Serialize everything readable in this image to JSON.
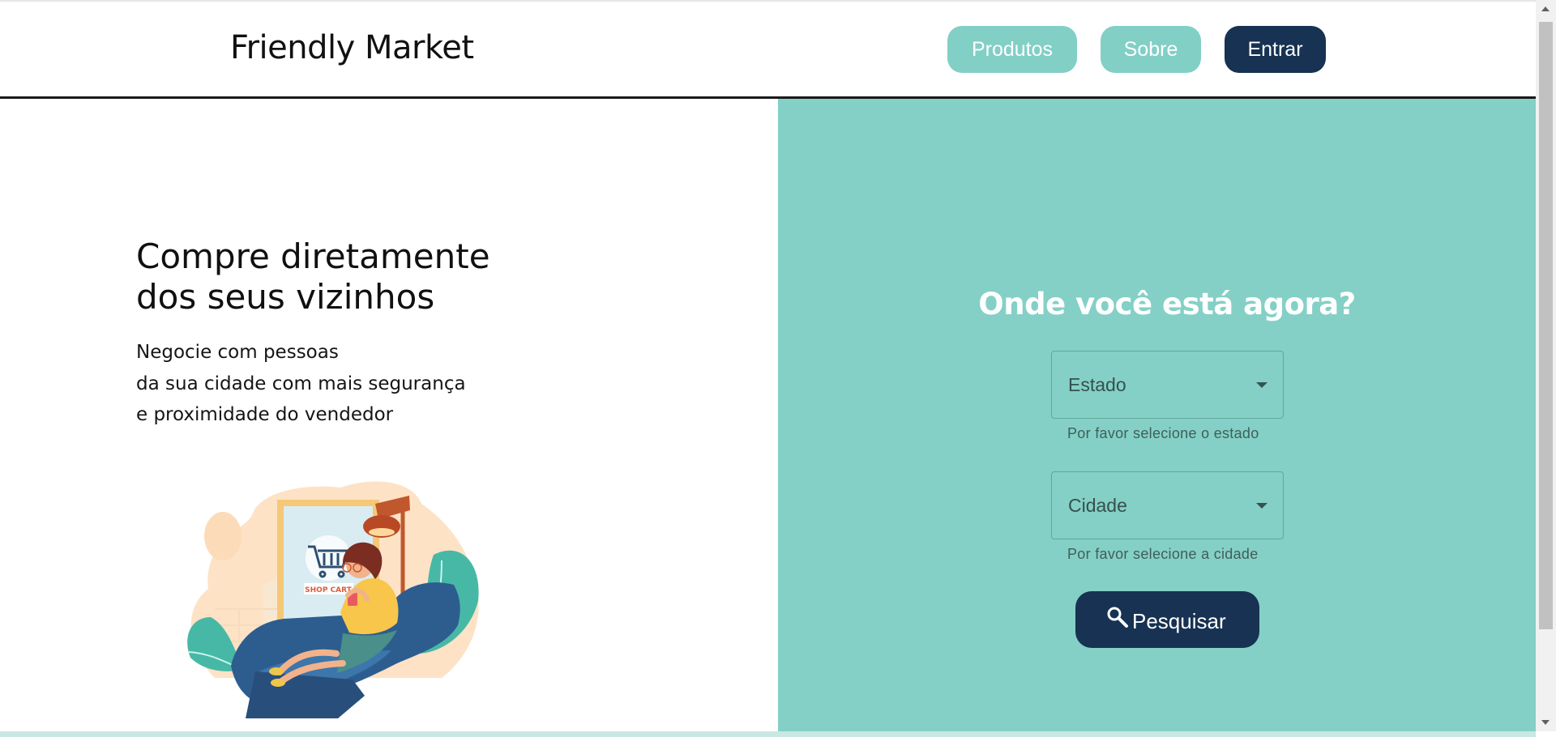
{
  "header": {
    "brand": "Friendly Market",
    "nav": {
      "products": "Produtos",
      "about": "Sobre",
      "login": "Entrar"
    }
  },
  "hero": {
    "title_lines": [
      "Compre diretamente",
      "dos seus vizinhos"
    ],
    "text_lines": [
      "Negocie com pessoas",
      "da sua cidade com mais segurança",
      "e proximidade do vendedor"
    ],
    "illustration_label": "SHOP CART"
  },
  "search_form": {
    "title": "Onde você está agora?",
    "state": {
      "value": "Estado",
      "helper": "Por favor selecione o estado"
    },
    "city": {
      "value": "Cidade",
      "helper": "Por favor selecione a cidade"
    },
    "button_label": "Pesquisar"
  },
  "icons": {
    "dropdown": "chevron-down-icon",
    "search": "search-icon",
    "cart": "shopping-cart-icon"
  },
  "colors": {
    "teal": "#84d0c6",
    "button_teal": "#82cfc6",
    "navy": "#173252",
    "text": "#101010"
  }
}
